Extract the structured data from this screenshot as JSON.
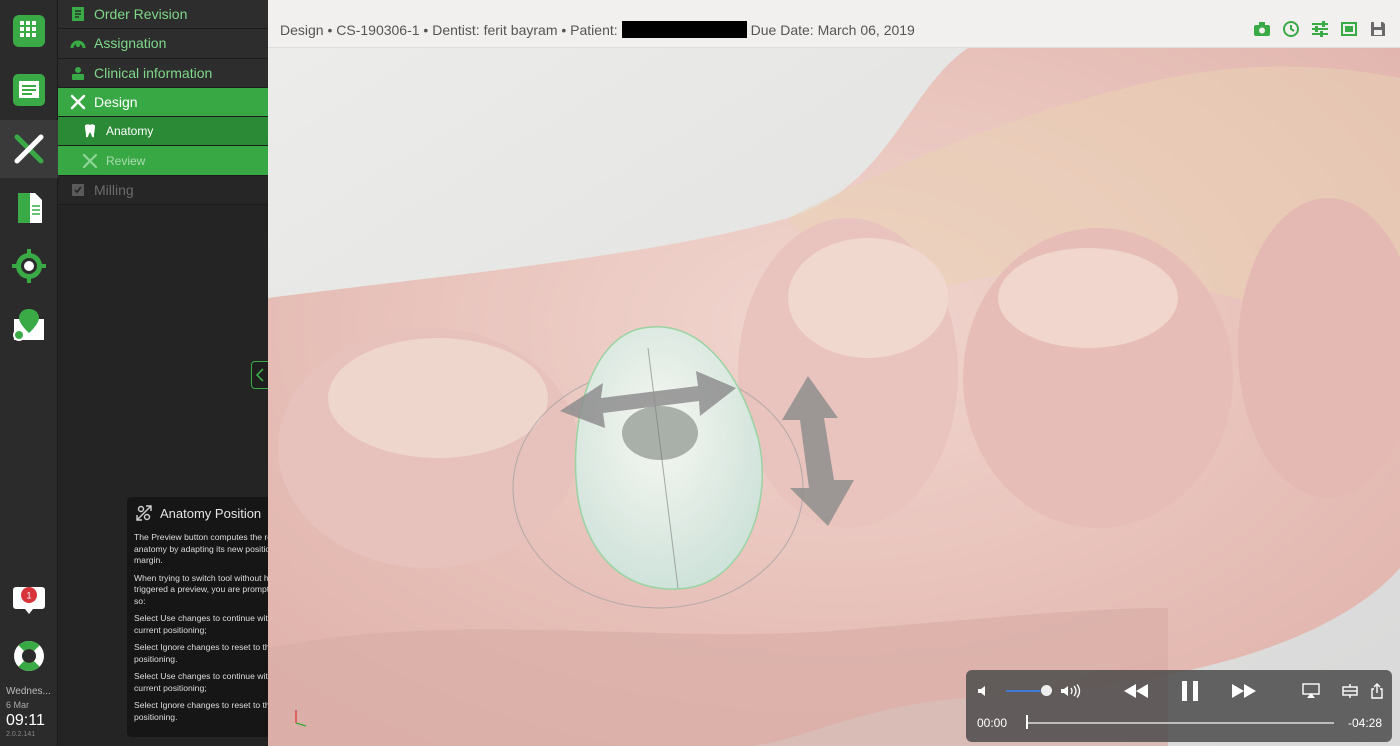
{
  "workflow": {
    "steps": [
      {
        "label": "Order Revision",
        "icon": "order-revision-icon"
      },
      {
        "label": "Assignation",
        "icon": "assignation-icon"
      },
      {
        "label": "Clinical information",
        "icon": "clinical-info-icon"
      },
      {
        "label": "Design",
        "icon": "design-tools-icon"
      },
      {
        "label": "Anatomy",
        "icon": "tooth-icon"
      },
      {
        "label": "Review",
        "icon": "review-icon"
      },
      {
        "label": "Milling",
        "icon": "milling-icon"
      }
    ]
  },
  "help": {
    "title": "Anatomy Position",
    "paragraphs": [
      "The Preview button computes the resulting anatomy by adapting its new position to the margin.",
      "When trying to switch tool without having triggered a preview, you are prompted to do so:",
      "Select Use changes to continue with your current positioning;",
      "Select Ignore changes to reset to the initial positioning.",
      "Select Use changes to continue with your current positioning;",
      "Select Ignore changes to reset to the initial positioning."
    ]
  },
  "rail": {
    "notification_count": "1",
    "day": "Wednes...",
    "date": "6 Mar",
    "time": "09:11",
    "version": "2.0.2.141"
  },
  "header": {
    "title_prefix": "Design • CS-190306-1 • Dentist: ferit bayram • Patient:",
    "due_date": "Due Date: March 06, 2019"
  },
  "player": {
    "current_time": "00:00",
    "remaining_time": "-04:28",
    "volume": 0.8,
    "progress": 0.0
  },
  "colors": {
    "accent": "#38a845",
    "accent_dark": "#2a8a36",
    "rail_bg": "#2b2b2b",
    "panel_bg": "#242424"
  }
}
